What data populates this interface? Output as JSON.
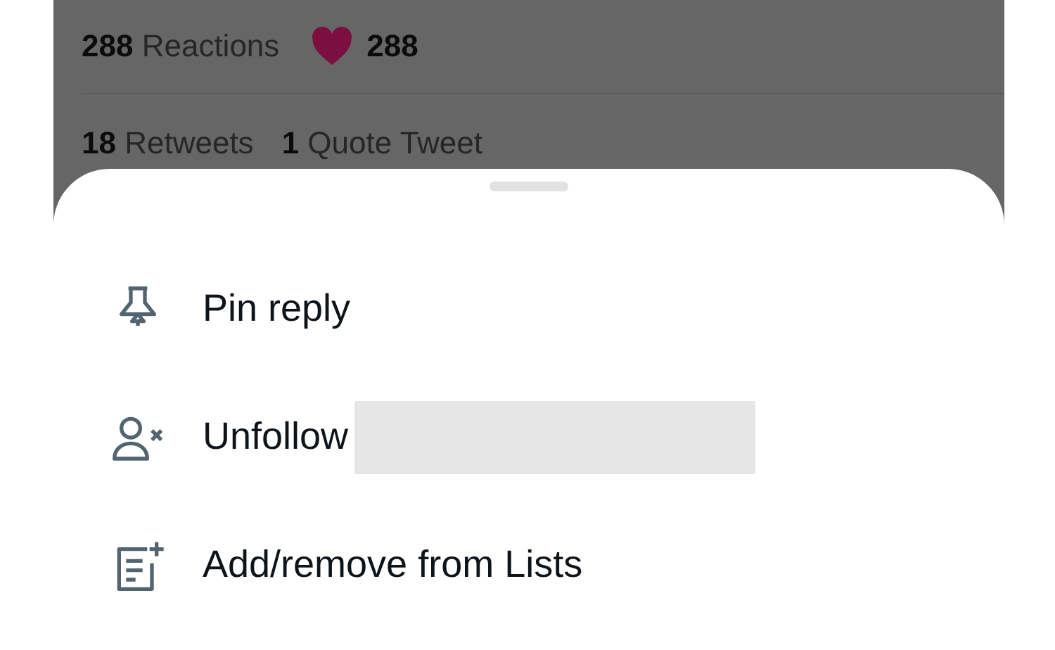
{
  "stats": {
    "reactions": "**288** Reactions",
    "like_count": "288"
  },
  "engagement": [
    {
      "text": "**18** Retweets"
    },
    {
      "text": "**1** Quote Tweet"
    }
  ],
  "menu": [
    {
      "kind": "pin",
      "label": "Pin reply",
      "redacted": false
    },
    {
      "kind": "unfollow",
      "label": "Unfollow",
      "redacted": true
    },
    {
      "kind": "lists",
      "label": "Add/remove from Lists",
      "redacted": false
    }
  ]
}
